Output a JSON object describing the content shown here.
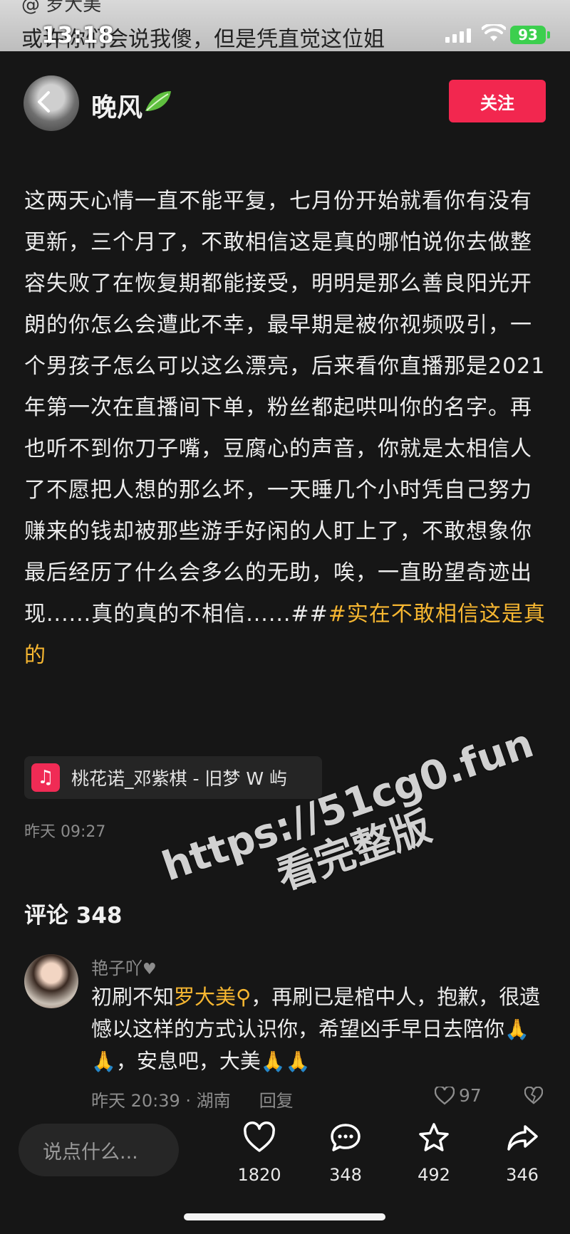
{
  "status_bar": {
    "time": "13:18",
    "ghost_title": "或许你们会说我傻，但是凭直觉这位姐",
    "ghost_top": "@ 罗大美",
    "battery": "93"
  },
  "header": {
    "author": "晚风",
    "follow_label": "关注"
  },
  "post": {
    "text": "这两天心情一直不能平复，七月份开始就看你有没有更新，三个月了，不敢相信这是真的哪怕说你去做整容失败了在恢复期都能接受，明明是那么善良阳光开朗的你怎么会遭此不幸，最早期是被你视频吸引，一个男孩子怎么可以这么漂亮，后来看你直播那是2021年第一次在直播间下单，粉丝都起哄叫你的名字。再也听不到你刀子嘴，豆腐心的声音，你就是太相信人了不愿把人想的那么坏，一天睡几个小时凭自己努力赚来的钱却被那些游手好闲的人盯上了，不敢想象你最后经历了什么会多么的无助，唉，一直盼望奇迹出现......真的真的不相信......##",
    "tag": "#实在不敢相信这是真的",
    "music": "桃花诺_邓紫棋 - 旧梦 W 屿",
    "date": "昨天 09:27"
  },
  "comments": {
    "title": "评论 348",
    "items": [
      {
        "user": "艳子吖",
        "text_a": "初刷不知",
        "mention": "罗大美",
        "text_b": "，再刷已是棺中人，抱歉，很遗憾以这样的方式认识你，希望凶手早日去陪你",
        "pray_a": "🙏🙏",
        "text_c": "，安息吧，大美",
        "pray_b": "🙏🙏",
        "time_location": "昨天 20:39 · 湖南",
        "reply_label": "回复",
        "likes": "97"
      }
    ]
  },
  "watermark": {
    "line1": "https://51cg0.fun",
    "line2": "看完整版"
  },
  "bottom_bar": {
    "input_placeholder": "说点什么...",
    "likes": "1820",
    "comments": "348",
    "favorites": "492",
    "shares": "346"
  },
  "colors": {
    "accent_red": "#f2274f",
    "tag_yellow": "#f7b731",
    "background": "#161616"
  }
}
